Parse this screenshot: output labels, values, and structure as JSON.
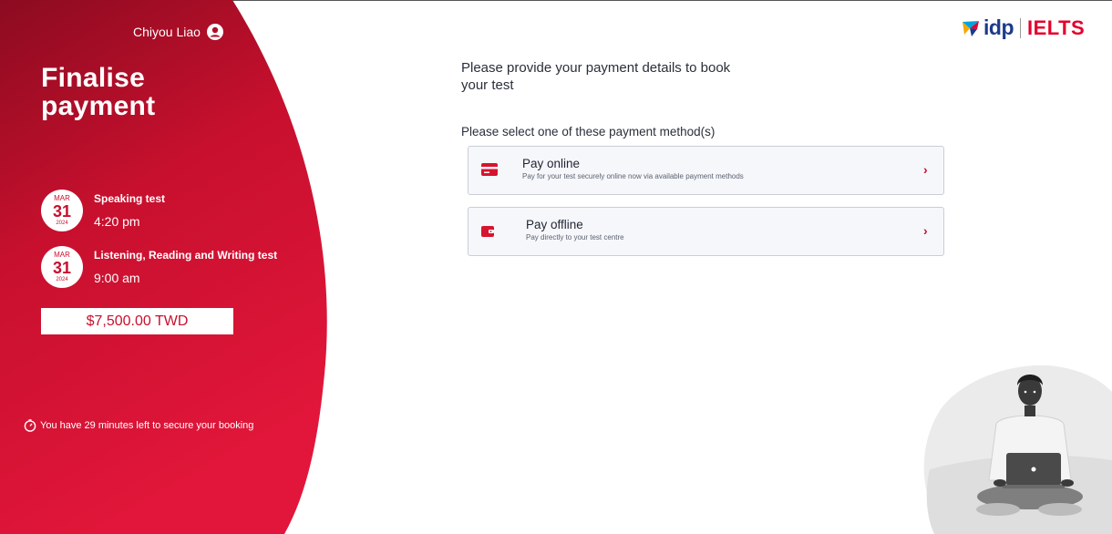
{
  "user": {
    "name": "Chiyou Liao"
  },
  "page": {
    "title_line1": "Finalise",
    "title_line2": "payment"
  },
  "tests": [
    {
      "month": "MAR",
      "day": "31",
      "year": "2024",
      "name": "Speaking test",
      "time": "4:20 pm"
    },
    {
      "month": "MAR",
      "day": "31",
      "year": "2024",
      "name": "Listening, Reading and Writing test",
      "time": "9:00 am"
    }
  ],
  "price": "$7,500.00 TWD",
  "timer_text": "You have 29 minutes left to secure your booking",
  "logo": {
    "idp": "idp",
    "ielts": "IELTS"
  },
  "main": {
    "heading": "Please provide your payment details to book your test",
    "subheading": "Please select one of these payment method(s)",
    "methods": [
      {
        "title": "Pay online",
        "description": "Pay for your test securely online now via available payment methods",
        "icon": "credit-card-icon"
      },
      {
        "title": "Pay offline",
        "description": "Pay directly to your test centre",
        "icon": "wallet-icon"
      }
    ]
  },
  "colors": {
    "brand_red": "#c8102e",
    "dark_red": "#8e0c22",
    "idp_blue": "#1d3a8a"
  }
}
